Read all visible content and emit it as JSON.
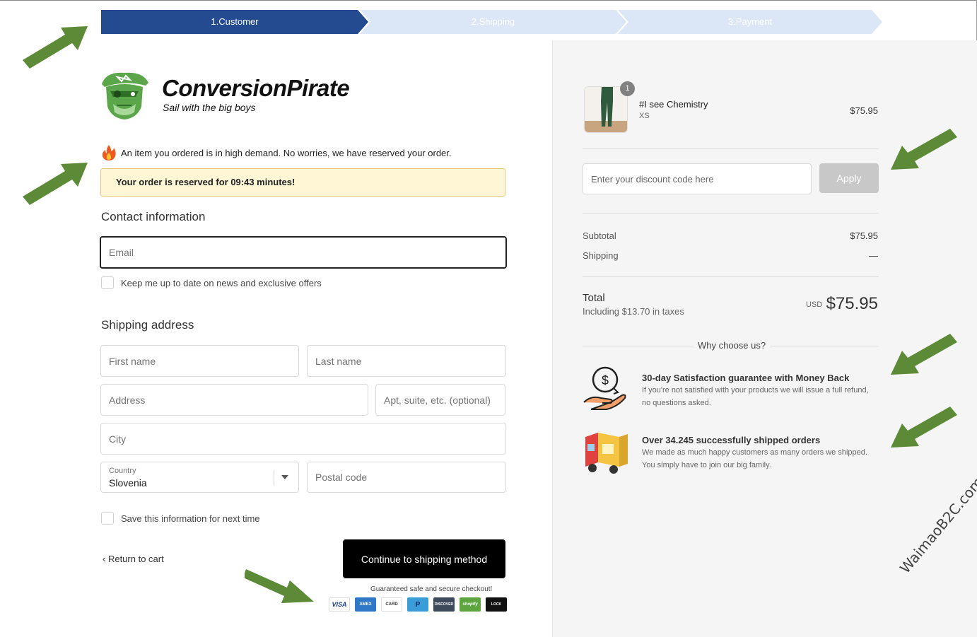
{
  "steps": [
    {
      "label": "1.Customer",
      "state": "active"
    },
    {
      "label": "2.Shipping",
      "state": "inactive"
    },
    {
      "label": "3.Payment",
      "state": "inactive"
    }
  ],
  "brand": {
    "name": "ConversionPirate",
    "tagline": "Sail with the big boys",
    "icon": "pirate-logo"
  },
  "notice": {
    "demand_text": "An item you ordered is in high demand. No worries, we have reserved your order.",
    "demand_icon": "fire-icon",
    "reserve_text": "Your order is reserved for 09:43 minutes!"
  },
  "contact": {
    "title": "Contact information",
    "email_placeholder": "Email",
    "newsletter_label": "Keep me up to date on news and exclusive offers"
  },
  "shipping": {
    "title": "Shipping address",
    "first_name": "First name",
    "last_name": "Last name",
    "address": "Address",
    "apt": "Apt, suite, etc. (optional)",
    "city": "City",
    "country_label": "Country",
    "country_value": "Slovenia",
    "postal": "Postal code",
    "save_label": "Save this information for next time"
  },
  "actions": {
    "return_label": "Return to cart",
    "continue_label": "Continue to shipping method",
    "secure_text": "Guaranteed safe and secure checkout!",
    "payment_icons": [
      "VISA",
      "AMEX",
      "CARD",
      "P",
      "DISCOVER",
      "shopify",
      "LOCK"
    ]
  },
  "cart": {
    "item_name": "#I see Chemistry",
    "item_variant": "XS",
    "item_qty": "1",
    "item_price": "$75.95",
    "discount_placeholder": "Enter your discount code here",
    "apply_label": "Apply",
    "subtotal_label": "Subtotal",
    "subtotal_value": "$75.95",
    "shipping_label": "Shipping",
    "shipping_value": "—",
    "total_label": "Total",
    "tax_label": "Including $13.70 in taxes",
    "currency": "USD",
    "total_value": "$75.95"
  },
  "why": {
    "title": "Why choose us?",
    "features": [
      {
        "title": "30-day Satisfaction guarantee with Money Back",
        "desc": "If you're not satisfied with your products we will issue a full refund, no questions asked.",
        "icon": "money-back-icon"
      },
      {
        "title": "Over 34.245 successfully shipped orders",
        "desc": "We made as much happy customers as many orders we shipped. You simply have to join our big family.",
        "icon": "delivery-truck-icon"
      }
    ]
  },
  "watermark": "WaimaoB2C.com",
  "colors": {
    "step_active": "#244a8f",
    "step_inactive": "#dbe6f7",
    "arrow": "#5d8a37",
    "reserve_bg": "#fff6d6"
  }
}
